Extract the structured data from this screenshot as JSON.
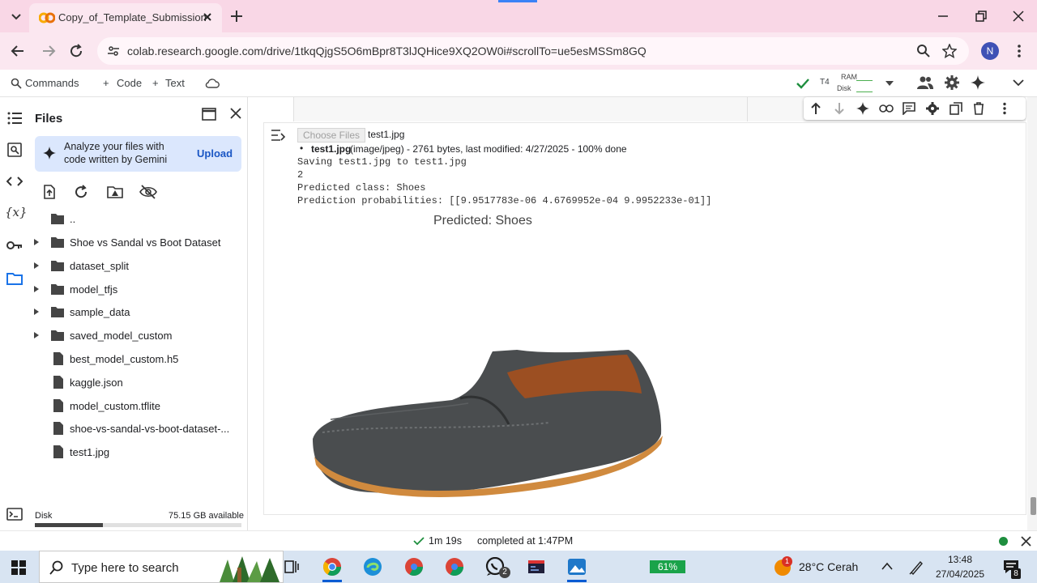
{
  "browser": {
    "tab_title": "Copy_of_Template_Submission",
    "url": "colab.research.google.com/drive/1tkqQjgS5O6mBpr8T3lJQHice9XQ2OW0i#scrollTo=ue5esMSSm8GQ",
    "profile_initial": "N"
  },
  "colab_toolbar": {
    "commands": "Commands",
    "code": "Code",
    "text": "Text",
    "runtime": "T4",
    "ram_label": "RAM",
    "disk_label": "Disk"
  },
  "files_panel": {
    "title": "Files",
    "gemini_line1": "Analyze your files with",
    "gemini_line2": "code written by Gemini",
    "upload": "Upload",
    "items": [
      {
        "label": "..",
        "type": "parent"
      },
      {
        "label": "Shoe vs Sandal vs Boot Dataset",
        "type": "folder"
      },
      {
        "label": "dataset_split",
        "type": "folder"
      },
      {
        "label": "model_tfjs",
        "type": "folder"
      },
      {
        "label": "sample_data",
        "type": "folder"
      },
      {
        "label": "saved_model_custom",
        "type": "folder"
      },
      {
        "label": "best_model_custom.h5",
        "type": "file"
      },
      {
        "label": "kaggle.json",
        "type": "file"
      },
      {
        "label": "model_custom.tflite",
        "type": "file"
      },
      {
        "label": "shoe-vs-sandal-vs-boot-dataset-...",
        "type": "file"
      },
      {
        "label": "test1.jpg",
        "type": "file"
      }
    ],
    "disk_label": "Disk",
    "disk_available": "75.15 GB available",
    "disk_used_fraction": 0.33
  },
  "output": {
    "choose_files": "Choose Files",
    "chosen_file": "test1.jpg",
    "bullet_name": "test1.jpg",
    "bullet_meta": "(image/jpeg) - 2761 bytes, last modified: 4/27/2025 - 100% done",
    "line_saving": "Saving test1.jpg to test1.jpg",
    "line_index": "2",
    "line_class": "Predicted class: Shoes",
    "line_probs": "Prediction probabilities: [[9.9517783e-06 4.6769952e-04 9.9952233e-01]]",
    "plot_title": "Predicted: Shoes"
  },
  "statusbar": {
    "elapsed": "1m 19s",
    "completed": "completed at 1:47PM"
  },
  "taskbar": {
    "search_placeholder": "Type here to search",
    "whatsapp_badge": "2",
    "battery": "61%",
    "weather_badge": "1",
    "weather": "28°C Cerah",
    "time": "13:48",
    "date": "27/04/2025",
    "notif_badge": "8"
  }
}
